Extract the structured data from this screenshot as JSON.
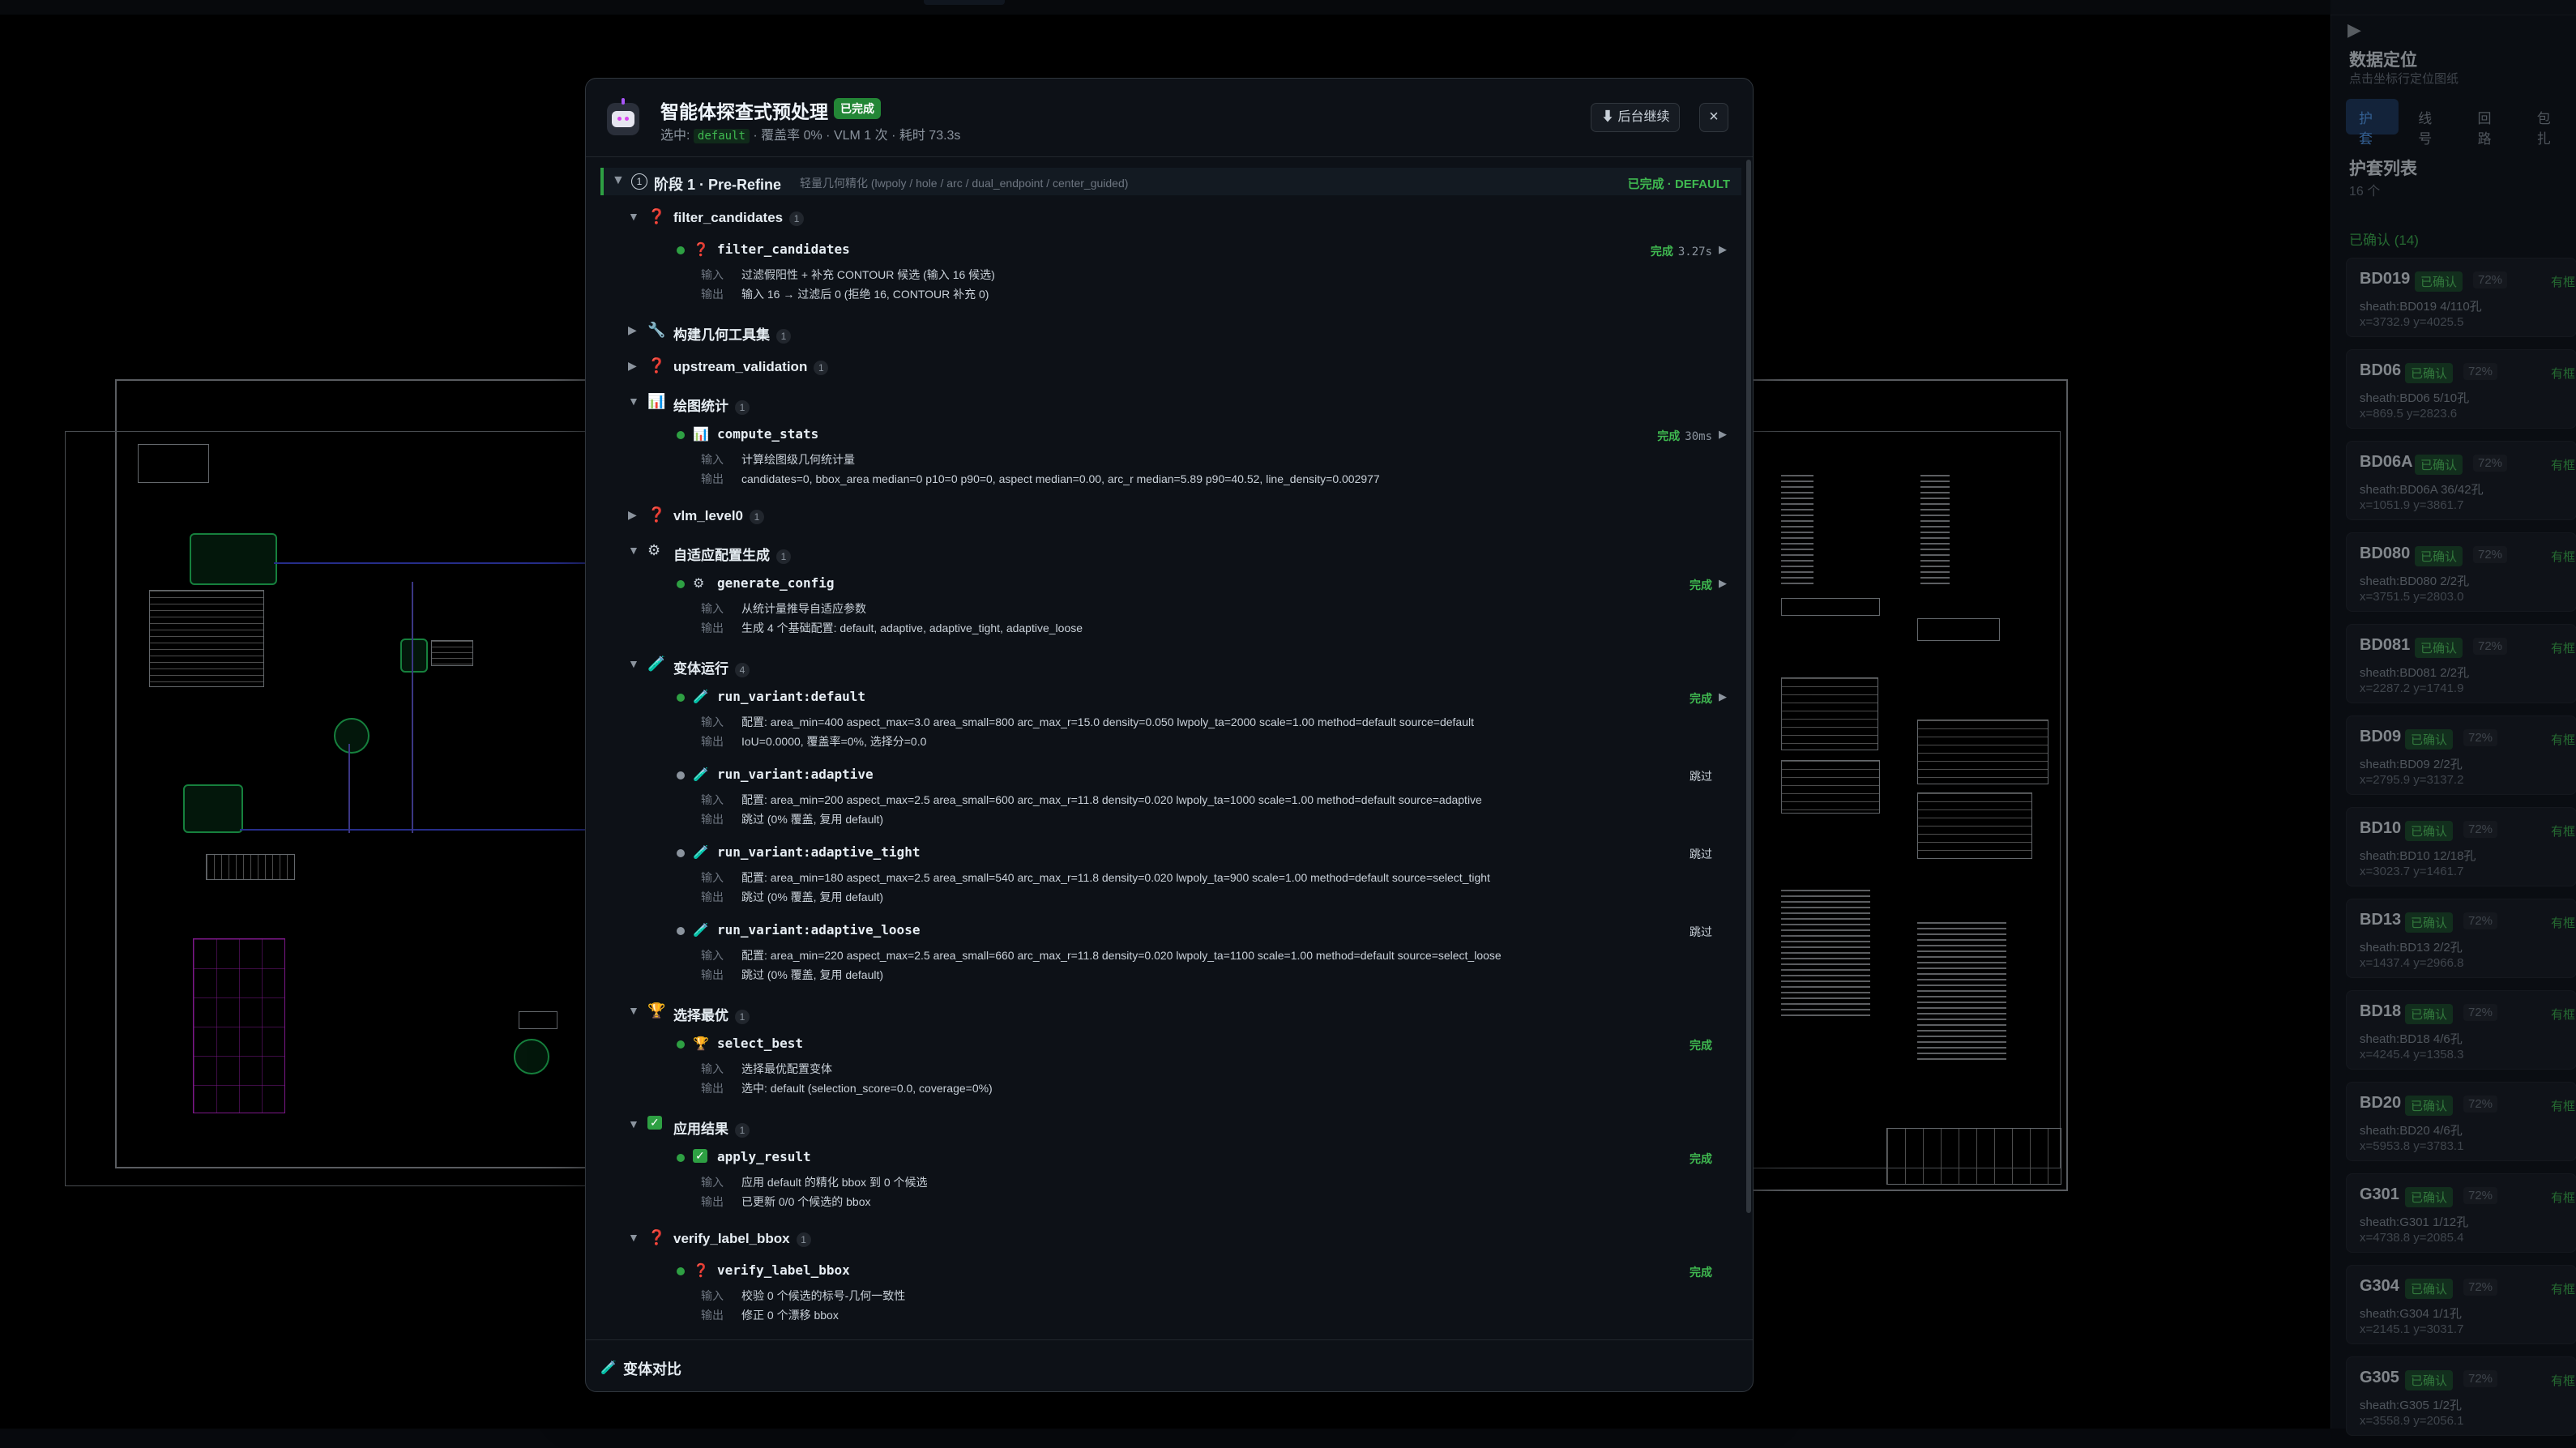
{
  "colors": {
    "accent_green": "#3fb950",
    "background": "#0d1117",
    "cad_wire": "#3b46d4",
    "cad_highlight": "#22c55e",
    "cad_magenta": "#c026d3"
  },
  "modal": {
    "title": "智能体探查式预处理",
    "status_badge": "已完成",
    "subtitle_prefix": "选中:",
    "selected_variant": "default",
    "subtitle_rest": "· 覆盖率 0% · VLM 1 次 · 耗时 73.3s",
    "background_button": "后台继续",
    "background_button_icon": "down-arrow-icon",
    "close_label": "×",
    "stage": {
      "caret": "▼",
      "number": "1",
      "label": "阶段 1 · Pre-Refine",
      "description": "轻量几何精化 (lwpoly / hole / arc / dual_endpoint / center_guided)",
      "status": "已完成 · DEFAULT"
    },
    "groups": [
      {
        "caret": "▼",
        "icon": "❓",
        "label": "filter_candidates",
        "count": "1",
        "items": [
          {
            "icon": "❓",
            "name": "filter_candidates",
            "status": "完成",
            "duration": "3.27s",
            "play": "▶",
            "input_label": "输入",
            "input": "过滤假阳性 + 补充 CONTOUR 候选 (输入 16 候选)",
            "output_label": "输出",
            "output": "输入 16 → 过滤后 0 (拒绝 16, CONTOUR 补充 0)"
          }
        ]
      },
      {
        "caret": "▶",
        "icon": "🔧",
        "label": "构建几何工具集",
        "count": "1",
        "items": []
      },
      {
        "caret": "▶",
        "icon": "❓",
        "label": "upstream_validation",
        "count": "1",
        "items": []
      },
      {
        "caret": "▼",
        "icon": "📊",
        "label": "绘图统计",
        "count": "1",
        "items": [
          {
            "icon": "📊",
            "name": "compute_stats",
            "status": "完成",
            "duration": "30ms",
            "play": "▶",
            "input_label": "输入",
            "input": "计算绘图级几何统计量",
            "output_label": "输出",
            "output": "candidates=0, bbox_area median=0 p10=0 p90=0, aspect median=0.00, arc_r median=5.89 p90=40.52, line_density=0.002977"
          }
        ]
      },
      {
        "caret": "▶",
        "icon": "❓",
        "label": "vlm_level0",
        "count": "1",
        "items": []
      },
      {
        "caret": "▼",
        "icon": "⚙",
        "label": "自适应配置生成",
        "count": "1",
        "items": [
          {
            "icon": "⚙",
            "name": "generate_config",
            "status": "完成",
            "duration": "",
            "play": "▶",
            "input_label": "输入",
            "input": "从统计量推导自适应参数",
            "output_label": "输出",
            "output": "生成 4 个基础配置: default, adaptive, adaptive_tight, adaptive_loose"
          }
        ]
      },
      {
        "caret": "▼",
        "icon": "🧪",
        "label": "变体运行",
        "count": "4",
        "items": [
          {
            "icon": "🧪",
            "name": "run_variant:default",
            "status": "完成",
            "duration": "",
            "play": "▶",
            "input_label": "输入",
            "input": "配置: area_min=400 aspect_max=3.0 area_small=800 arc_max_r=15.0 density=0.050 lwpoly_ta=2000 scale=1.00 method=default source=default",
            "output_label": "输出",
            "output": "IoU=0.0000, 覆盖率=0%, 选择分=0.0"
          },
          {
            "icon": "🧪",
            "name": "run_variant:adaptive",
            "status": "跳过",
            "skipped": true,
            "duration": "",
            "play": "",
            "input_label": "输入",
            "input": "配置: area_min=200 aspect_max=2.5 area_small=600 arc_max_r=11.8 density=0.020 lwpoly_ta=1000 scale=1.00 method=default source=adaptive",
            "output_label": "输出",
            "output": "跳过 (0% 覆盖, 复用 default)"
          },
          {
            "icon": "🧪",
            "name": "run_variant:adaptive_tight",
            "status": "跳过",
            "skipped": true,
            "duration": "",
            "play": "",
            "input_label": "输入",
            "input": "配置: area_min=180 aspect_max=2.5 area_small=540 arc_max_r=11.8 density=0.020 lwpoly_ta=900 scale=1.00 method=default source=select_tight",
            "output_label": "输出",
            "output": "跳过 (0% 覆盖, 复用 default)"
          },
          {
            "icon": "🧪",
            "name": "run_variant:adaptive_loose",
            "status": "跳过",
            "skipped": true,
            "duration": "",
            "play": "",
            "input_label": "输入",
            "input": "配置: area_min=220 aspect_max=2.5 area_small=660 arc_max_r=11.8 density=0.020 lwpoly_ta=1100 scale=1.00 method=default source=select_loose",
            "output_label": "输出",
            "output": "跳过 (0% 覆盖, 复用 default)"
          }
        ]
      },
      {
        "caret": "▼",
        "icon": "🏆",
        "label": "选择最优",
        "count": "1",
        "items": [
          {
            "icon": "🏆",
            "name": "select_best",
            "status": "完成",
            "duration": "",
            "play": "",
            "input_label": "输入",
            "input": "选择最优配置变体",
            "output_label": "输出",
            "output": "选中: default (selection_score=0.0, coverage=0%)"
          }
        ]
      },
      {
        "caret": "▼",
        "icon": "✓",
        "label": "应用结果",
        "count": "1",
        "items": [
          {
            "icon": "✓",
            "name": "apply_result",
            "status": "完成",
            "duration": "",
            "play": "",
            "input_label": "输入",
            "input": "应用 default 的精化 bbox 到 0 个候选",
            "output_label": "输出",
            "output": "已更新 0/0 个候选的 bbox"
          }
        ]
      },
      {
        "caret": "▼",
        "icon": "❓",
        "label": "verify_label_bbox",
        "count": "1",
        "items": [
          {
            "icon": "❓",
            "name": "verify_label_bbox",
            "status": "完成",
            "duration": "",
            "play": "",
            "input_label": "输入",
            "input": "校验 0 个候选的标号-几何一致性",
            "output_label": "输出",
            "output": "修正 0 个漂移 bbox"
          }
        ]
      }
    ],
    "compare_icon": "🧪",
    "compare_label": "变体对比"
  },
  "sidebar": {
    "collapse_icon": "▶",
    "title": "数据定位",
    "subtitle": "点击坐标行定位图纸",
    "tabs": [
      "护套",
      "线号",
      "回路",
      "包扎"
    ],
    "active_tab": "护套",
    "list_title": "护套列表",
    "list_count": "16 个",
    "group_label": "已确认 (14)",
    "cards": [
      {
        "name": "BD019",
        "badge": "已确认",
        "pct": "72%",
        "extra": "有框",
        "line1": "sheath:BD019  4/110孔",
        "line2": "x=3732.9  y=4025.5"
      },
      {
        "name": "BD06",
        "badge": "已确认",
        "pct": "72%",
        "extra": "有框",
        "line1": "sheath:BD06  5/10孔",
        "line2": "x=869.5  y=2823.6"
      },
      {
        "name": "BD06A",
        "badge": "已确认",
        "pct": "72%",
        "extra": "有框",
        "line1": "sheath:BD06A  36/42孔",
        "line2": "x=1051.9  y=3861.7"
      },
      {
        "name": "BD080",
        "badge": "已确认",
        "pct": "72%",
        "extra": "有框",
        "line1": "sheath:BD080  2/2孔",
        "line2": "x=3751.5  y=2803.0"
      },
      {
        "name": "BD081",
        "badge": "已确认",
        "pct": "72%",
        "extra": "有框",
        "line1": "sheath:BD081  2/2孔",
        "line2": "x=2287.2  y=1741.9"
      },
      {
        "name": "BD09",
        "badge": "已确认",
        "pct": "72%",
        "extra": "有框",
        "line1": "sheath:BD09  2/2孔",
        "line2": "x=2795.9  y=3137.2"
      },
      {
        "name": "BD10",
        "badge": "已确认",
        "pct": "72%",
        "extra": "有框",
        "line1": "sheath:BD10  12/18孔",
        "line2": "x=3023.7  y=1461.7"
      },
      {
        "name": "BD13",
        "badge": "已确认",
        "pct": "72%",
        "extra": "有框",
        "line1": "sheath:BD13  2/2孔",
        "line2": "x=1437.4  y=2966.8"
      },
      {
        "name": "BD18",
        "badge": "已确认",
        "pct": "72%",
        "extra": "有框",
        "line1": "sheath:BD18  4/6孔",
        "line2": "x=4245.4  y=1358.3"
      },
      {
        "name": "BD20",
        "badge": "已确认",
        "pct": "72%",
        "extra": "有框",
        "line1": "sheath:BD20  4/6孔",
        "line2": "x=5953.8  y=3783.1"
      },
      {
        "name": "G301",
        "badge": "已确认",
        "pct": "72%",
        "extra": "有框",
        "line1": "sheath:G301  1/12孔",
        "line2": "x=4738.8  y=2085.4"
      },
      {
        "name": "G304",
        "badge": "已确认",
        "pct": "72%",
        "extra": "有框",
        "line1": "sheath:G304  1/1孔",
        "line2": "x=2145.1  y=3031.7"
      },
      {
        "name": "G305",
        "badge": "已确认",
        "pct": "72%",
        "extra": "有框",
        "line1": "sheath:G305  1/2孔",
        "line2": "x=3558.9  y=2056.1"
      }
    ]
  }
}
